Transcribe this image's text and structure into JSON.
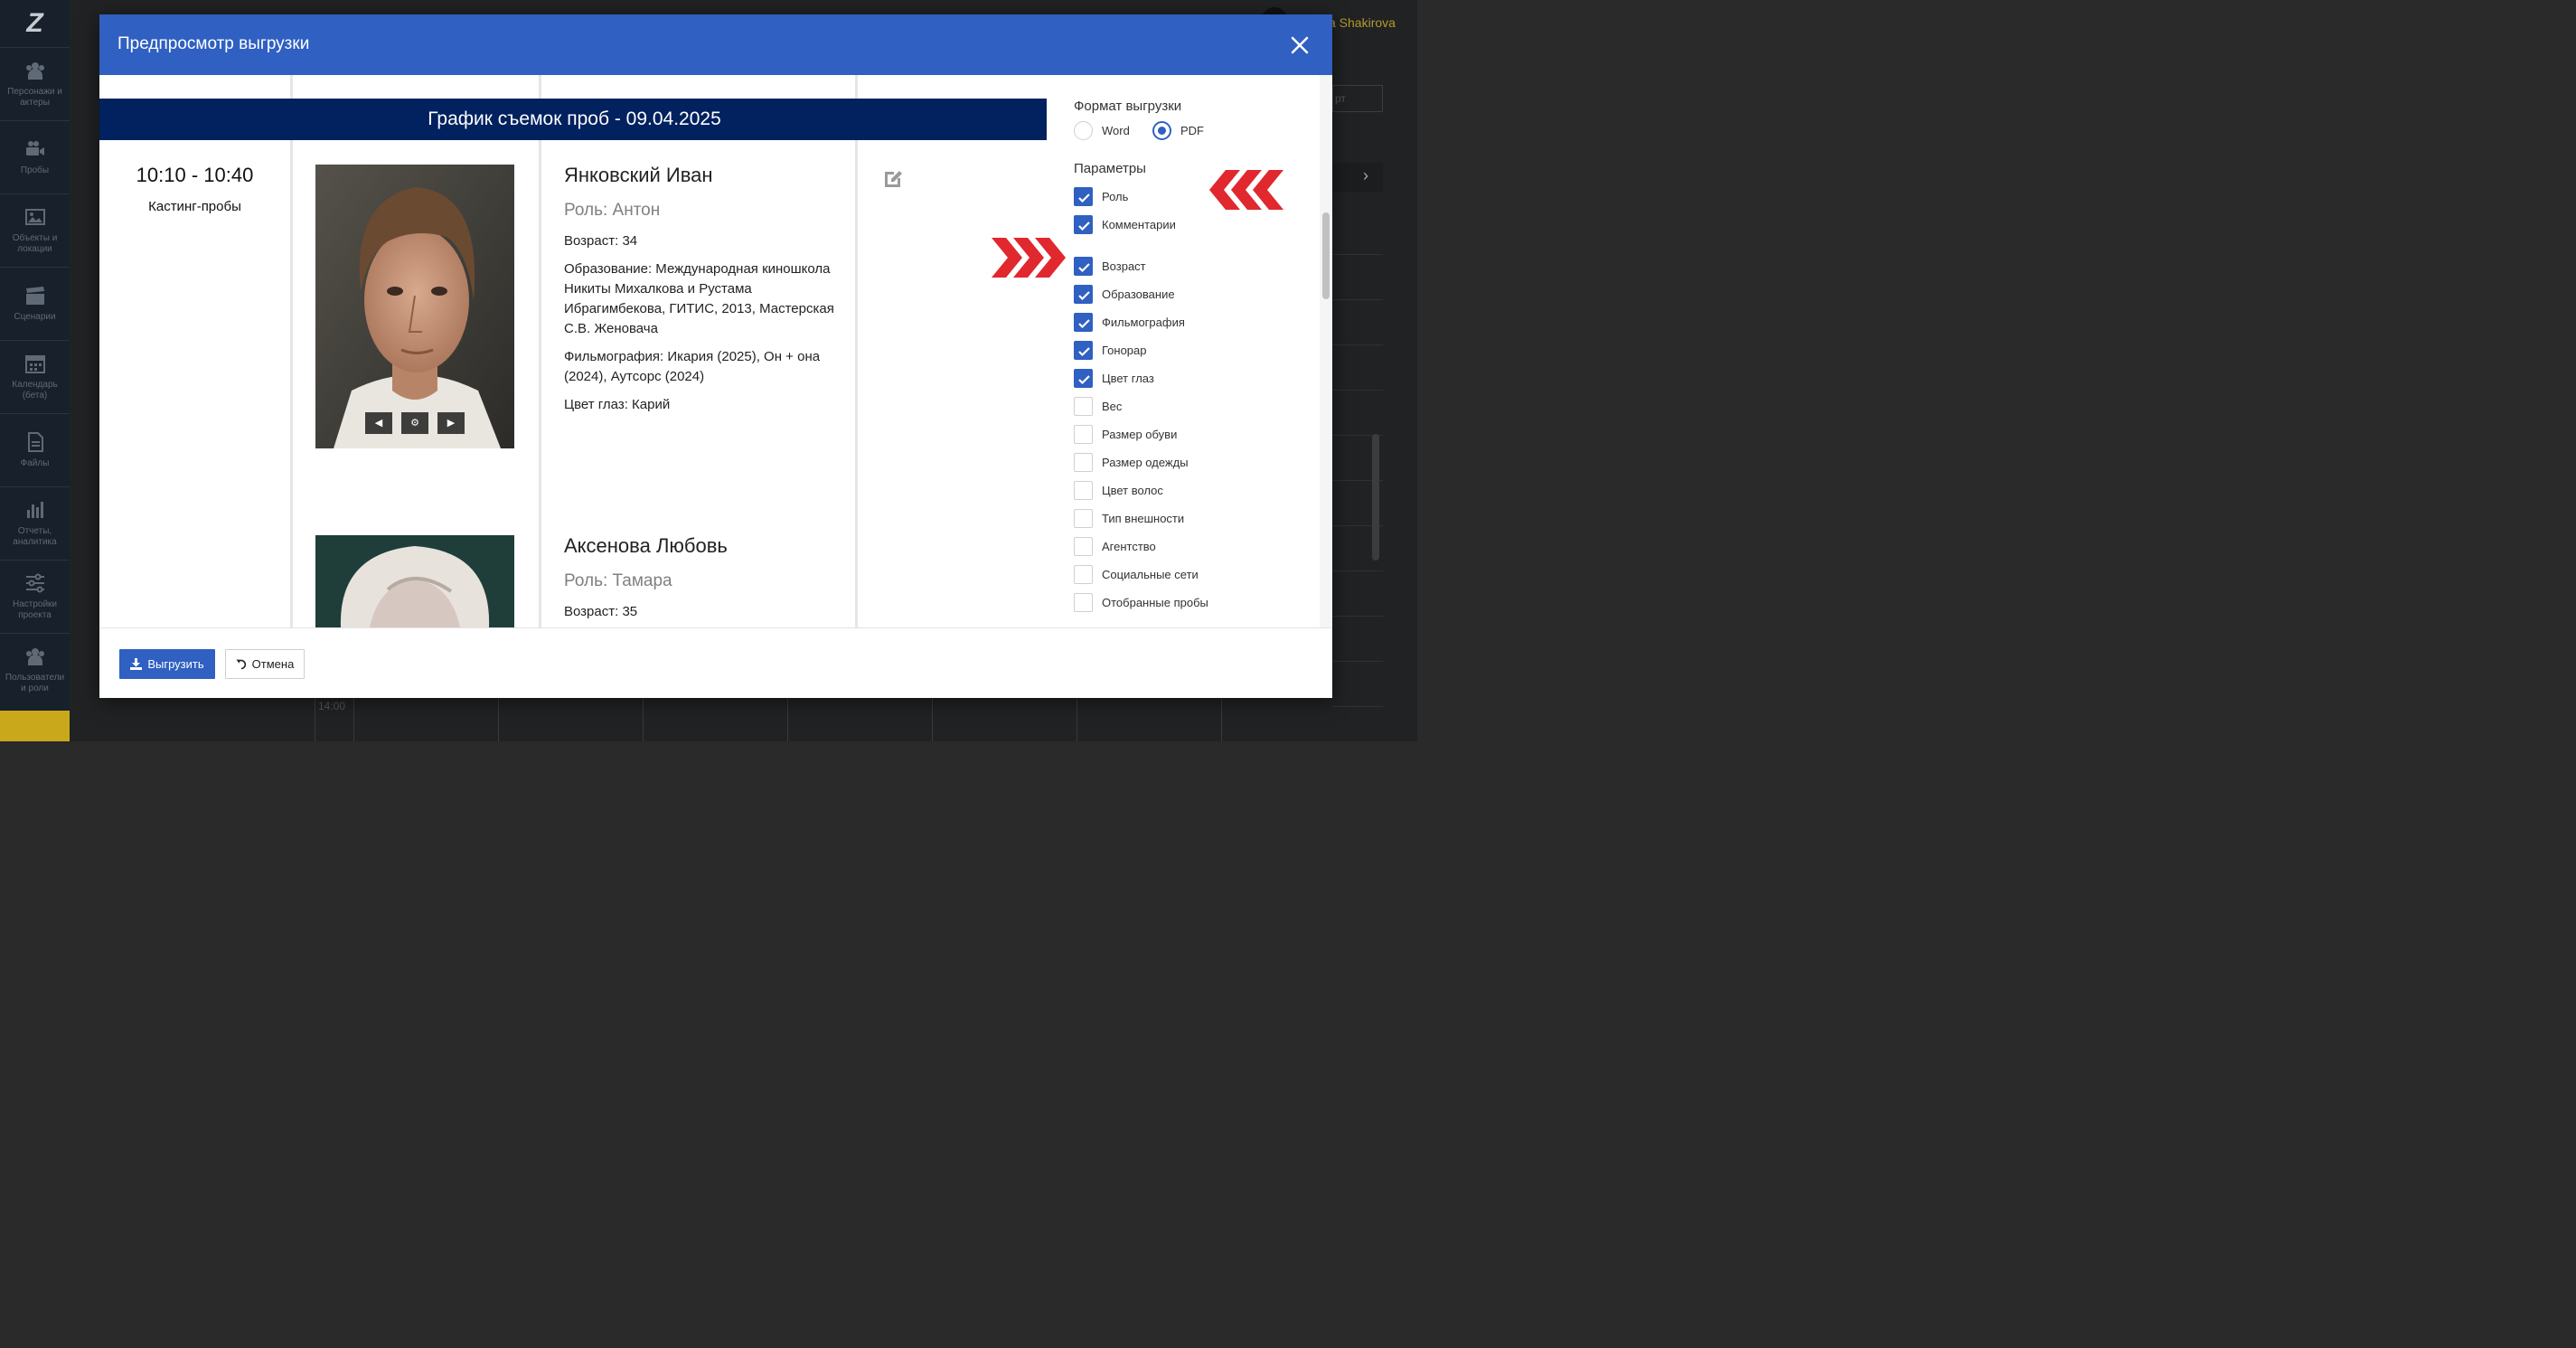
{
  "sidebar": {
    "logo": "Z",
    "items": [
      {
        "label": "Персонажи и актеры",
        "icon": "people-icon"
      },
      {
        "label": "Пробы",
        "icon": "video-camera-icon"
      },
      {
        "label": "Объекты и локации",
        "icon": "image-icon"
      },
      {
        "label": "Сценарии",
        "icon": "clapperboard-icon"
      },
      {
        "label": "Календарь (бета)",
        "icon": "calendar-icon"
      },
      {
        "label": "Файлы",
        "icon": "file-icon"
      },
      {
        "label": "Отчеты, аналитика",
        "icon": "bar-chart-icon"
      },
      {
        "label": "Настройки проекта",
        "icon": "sliders-icon"
      },
      {
        "label": "Пользователи и роли",
        "icon": "users-icon"
      }
    ]
  },
  "background": {
    "user_name": "a Shakirova",
    "export_label": "рт",
    "next_symbol": "›",
    "time_label": "14:00"
  },
  "modal": {
    "title": "Предпросмотр выгрузки",
    "close_symbol": "✕"
  },
  "preview": {
    "banner": "График съемок проб - 09.04.2025",
    "slot_time": "10:10 - 10:40",
    "slot_type": "Кастинг-пробы",
    "actors": [
      {
        "name": "Янковский Иван",
        "role": "Роль: Антон",
        "age": "Возраст: 34",
        "education": "Образование: Международная киношкола Никиты Михалкова и Рустама Ибрагимбекова, ГИТИС, 2013, Мастерская С.В. Женовача",
        "filmography": "Фильмография: Икария (2025), Он + она (2024), Аутсорс (2024)",
        "eye_color": "Цвет глаз: Карий"
      },
      {
        "name": "Аксенова Любовь",
        "role": "Роль: Тамара",
        "age": "Возраст: 35"
      }
    ],
    "photo_controls": {
      "prev": "◀",
      "settings": "⚙",
      "next": "▶"
    }
  },
  "panel": {
    "format_title": "Формат выгрузки",
    "formats": [
      {
        "label": "Word",
        "selected": false
      },
      {
        "label": "PDF",
        "selected": true
      }
    ],
    "params_title": "Параметры",
    "params": [
      {
        "label": "Роль",
        "checked": true
      },
      {
        "label": "Комментарии",
        "checked": true
      },
      {
        "label": "Возраст",
        "checked": true
      },
      {
        "label": "Образование",
        "checked": true
      },
      {
        "label": "Фильмография",
        "checked": true
      },
      {
        "label": "Гонорар",
        "checked": true
      },
      {
        "label": "Цвет глаз",
        "checked": true
      },
      {
        "label": "Вес",
        "checked": false
      },
      {
        "label": "Размер обуви",
        "checked": false
      },
      {
        "label": "Размер одежды",
        "checked": false
      },
      {
        "label": "Цвет волос",
        "checked": false
      },
      {
        "label": "Тип внешности",
        "checked": false
      },
      {
        "label": "Агентство",
        "checked": false
      },
      {
        "label": "Социальные сети",
        "checked": false
      },
      {
        "label": "Отобранные пробы",
        "checked": false
      }
    ]
  },
  "footer": {
    "export_label": "Выгрузить",
    "cancel_label": "Отмена"
  },
  "colors": {
    "header_blue": "#2f60c2",
    "banner_navy": "#01215f",
    "annotation_red": "#e0282e"
  }
}
